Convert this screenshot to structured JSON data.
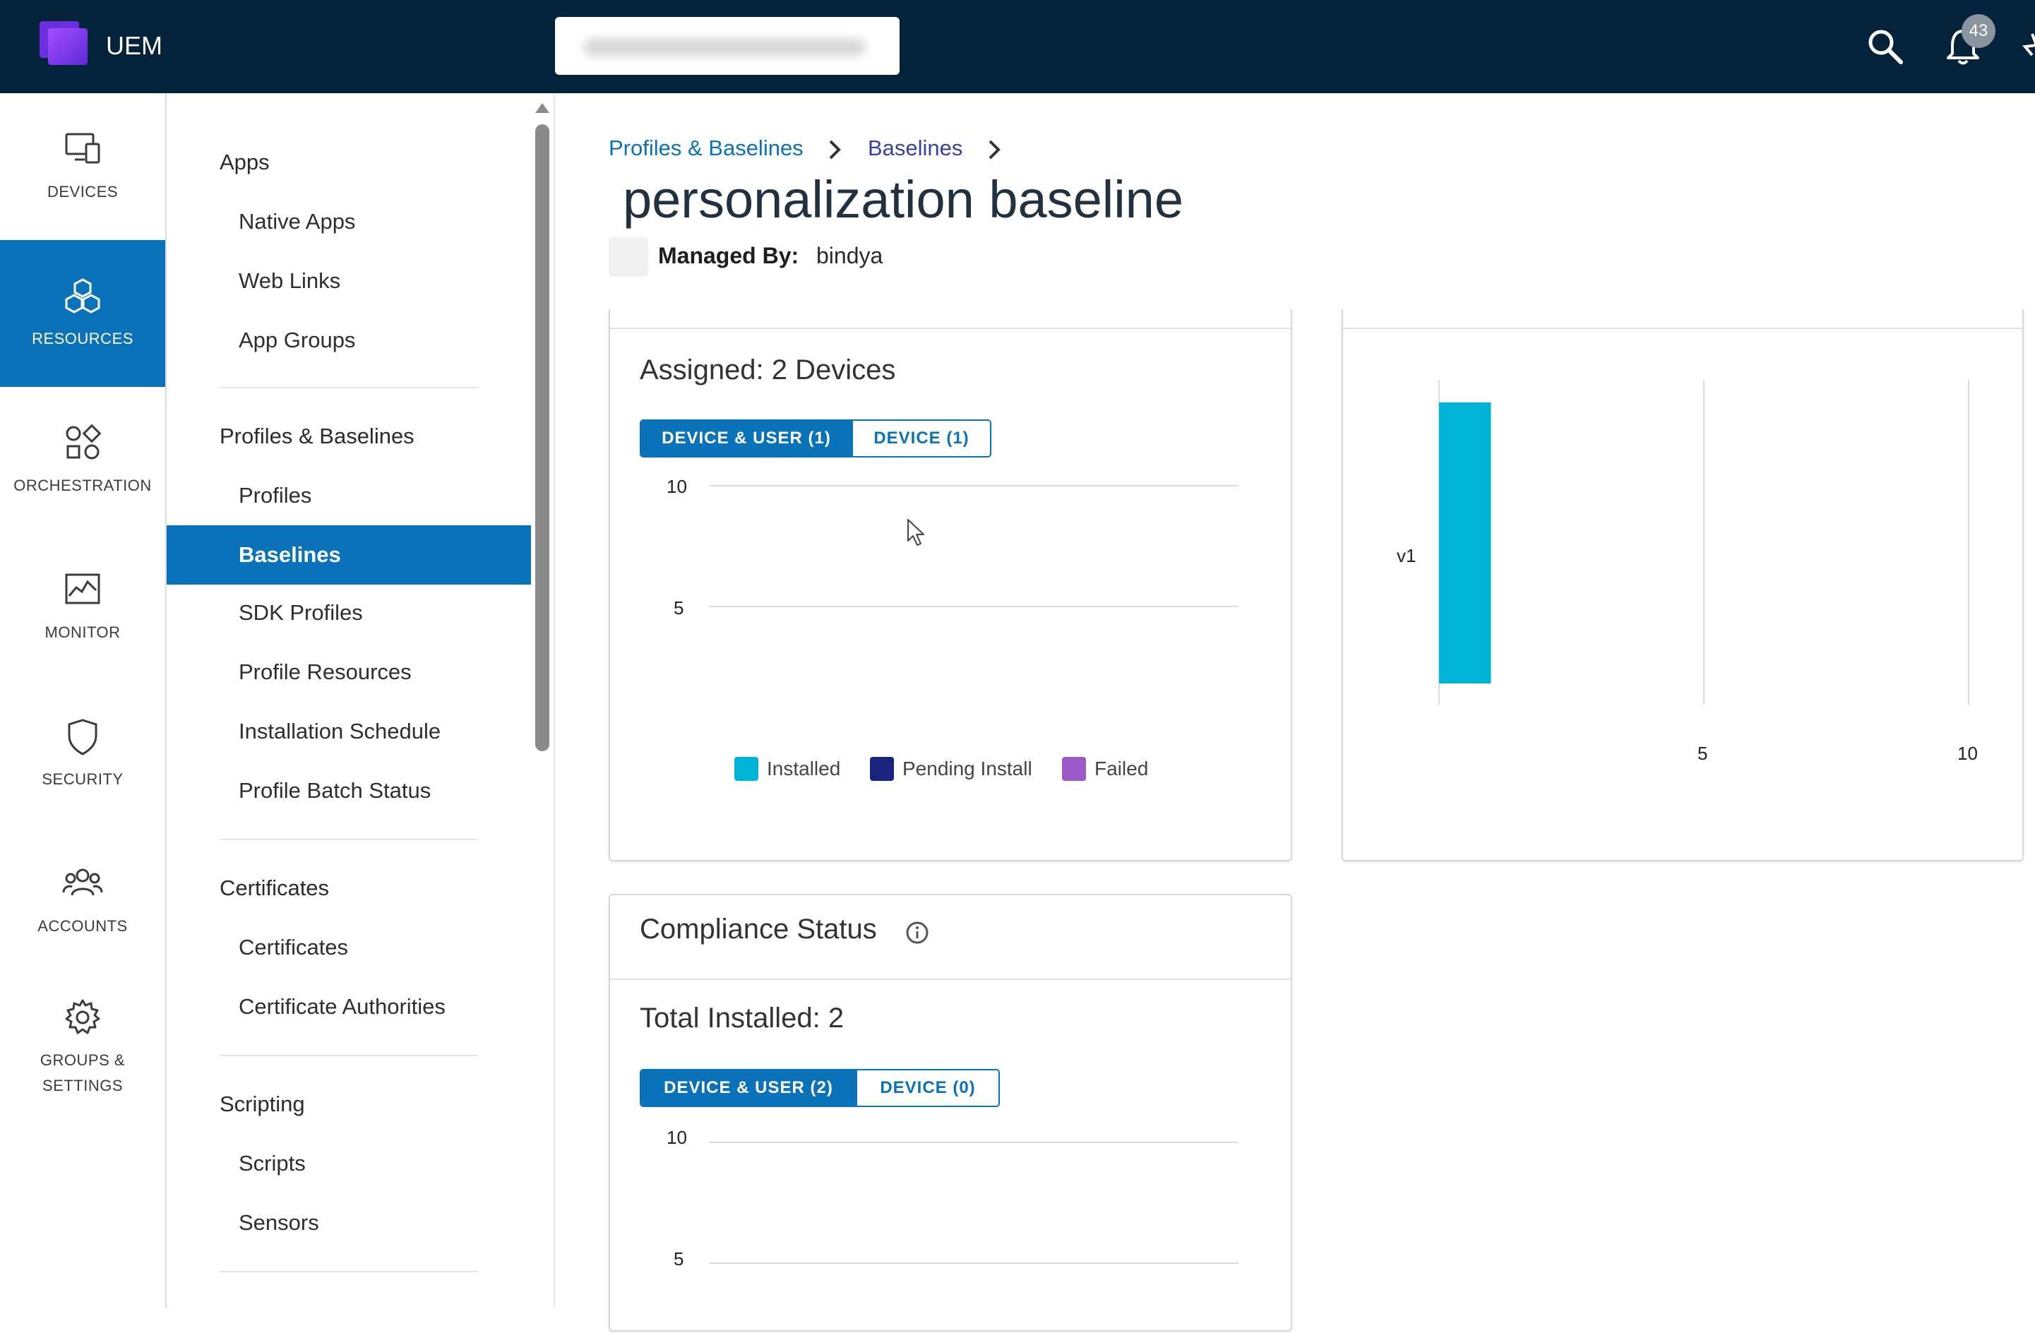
{
  "app": {
    "title": "UEM",
    "org_selector": "",
    "notifications_count": "43"
  },
  "rail": [
    {
      "id": "devices",
      "label": "DEVICES",
      "icon": "devices-icon",
      "active": false
    },
    {
      "id": "resources",
      "label": "RESOURCES",
      "icon": "resources-icon",
      "active": true
    },
    {
      "id": "orchestration",
      "label": "ORCHESTRATION",
      "icon": "orchestration-icon",
      "active": false
    },
    {
      "id": "monitor",
      "label": "MONITOR",
      "icon": "monitor-icon",
      "active": false
    },
    {
      "id": "security",
      "label": "SECURITY",
      "icon": "shield-icon",
      "active": false
    },
    {
      "id": "accounts",
      "label": "ACCOUNTS",
      "icon": "users-icon",
      "active": false
    },
    {
      "id": "groups",
      "label": "GROUPS &\nSETTINGS",
      "icon": "gear-icon",
      "active": false
    }
  ],
  "subnav": {
    "apps": {
      "heading": "Apps",
      "items": [
        "Native Apps",
        "Web Links",
        "App Groups"
      ]
    },
    "profiles": {
      "heading": "Profiles & Baselines",
      "items": [
        "Profiles",
        "Baselines",
        "SDK Profiles",
        "Profile Resources",
        "Installation Schedule",
        "Profile Batch Status"
      ],
      "active": "Baselines"
    },
    "certs": {
      "heading": "Certificates",
      "items": [
        "Certificates",
        "Certificate Authorities"
      ]
    },
    "scripting": {
      "heading": "Scripting",
      "items": [
        "Scripts",
        "Sensors"
      ]
    }
  },
  "breadcrumb": {
    "level1": "Profiles & Baselines",
    "level2": "Baselines"
  },
  "page": {
    "title": "personalization baseline",
    "managed_by_label": "Managed By:",
    "managed_by_value": "bindya"
  },
  "assigned_card": {
    "heading": "Assigned: 2 Devices",
    "tabs": [
      "DEVICE & USER (1)",
      "DEVICE (1)"
    ],
    "legend": [
      {
        "label": "Installed",
        "color": "#00b4d8"
      },
      {
        "label": "Pending Install",
        "color": "#1a237e"
      },
      {
        "label": "Failed",
        "color": "#9c5ac9"
      }
    ]
  },
  "compliance_card": {
    "heading": "Compliance Status",
    "subheading": "Total Installed: 2",
    "tabs": [
      "DEVICE & USER (2)",
      "DEVICE (0)"
    ]
  },
  "colors": {
    "topbar": "#04223a",
    "accent": "#0a72b8",
    "installed": "#00b4d8",
    "pending": "#1a237e",
    "failed": "#9c5ac9"
  },
  "chart_data": [
    {
      "type": "bar",
      "title": "Assigned: 2 Devices",
      "categories": [
        ""
      ],
      "series": [
        {
          "name": "Installed",
          "values": [
            0
          ]
        },
        {
          "name": "Pending Install",
          "values": [
            1
          ]
        },
        {
          "name": "Failed",
          "values": [
            0
          ]
        }
      ],
      "y_ticks": [
        "10",
        "5"
      ],
      "ylim": [
        0,
        10
      ],
      "grid": true,
      "legend": "bottom"
    },
    {
      "type": "bar",
      "orientation": "horizontal",
      "categories": [
        "v1"
      ],
      "series": [
        {
          "name": "Installed",
          "values": [
            2
          ]
        }
      ],
      "x_ticks": [
        "5",
        "10"
      ],
      "xlim": [
        0,
        10
      ],
      "grid": true
    },
    {
      "type": "bar",
      "title": "Total Installed: 2",
      "categories": [
        ""
      ],
      "series": [],
      "y_ticks": [
        "10",
        "5"
      ],
      "ylim": [
        0,
        10
      ],
      "grid": true
    }
  ]
}
